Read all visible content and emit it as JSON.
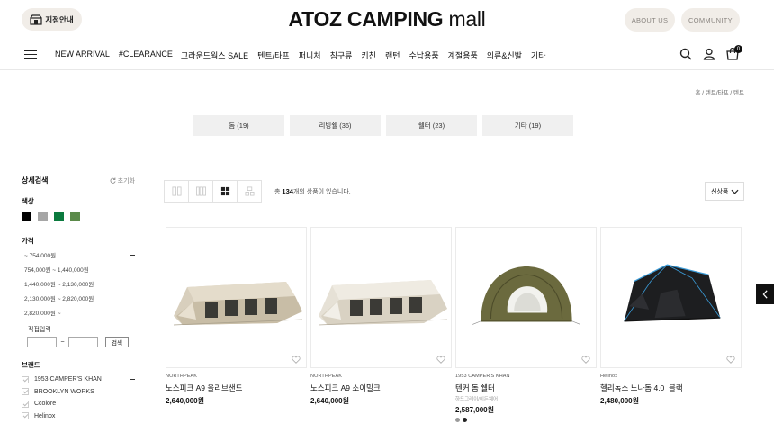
{
  "header": {
    "store_label": "지점안내",
    "logo_bold": "ATOZ CAMPING",
    "logo_light": "mall",
    "about_label": "ABOUT US",
    "community_label": "COMMUNITY"
  },
  "nav": {
    "items": [
      "NEW ARRIVAL",
      "#CLEARANCE",
      "그라운드웍스 SALE",
      "텐트/타프",
      "퍼니처",
      "침구류",
      "키친",
      "랜턴",
      "수납용품",
      "계절용품",
      "의류&신발",
      "기타"
    ],
    "cart_count": "0",
    "icons": [
      "search-icon",
      "user-icon",
      "cart-icon"
    ]
  },
  "breadcrumb": "홈 / 텐트/타프 / 텐트",
  "categories": [
    "돔 (19)",
    "리빙쉘 (36)",
    "쉘터 (23)",
    "기타 (19)"
  ],
  "sidebar": {
    "title": "상세검색",
    "reset": "초기화",
    "color_title": "색상",
    "colors": [
      "#000000",
      "#a6a6a6",
      "#0b7a3e",
      "#5b8a4a"
    ],
    "price_title": "가격",
    "prices": [
      "~ 754,000원",
      "754,000원 ~ 1,440,000원",
      "1,440,000원 ~ 2,130,000원",
      "2,130,000원 ~ 2,820,000원",
      "2,820,000원 ~"
    ],
    "direct_label": "직접입력",
    "search_btn": "검색",
    "brand_title": "브랜드",
    "brands": [
      "1953 CAMPER'S KHAN",
      "BROOKLYN WORKS",
      "Ccolore",
      "Helinox"
    ]
  },
  "toolbar": {
    "count_prefix": "총",
    "count": "134",
    "count_suffix": "개의 상품이 있습니다.",
    "sort_label": "신상품"
  },
  "products": [
    {
      "brand": "NORTHPEAK",
      "name": "노스피크 A9 올리브샌드",
      "sub": "",
      "price": "2,640,000원"
    },
    {
      "brand": "NORTHPEAK",
      "name": "노스피크 A9 소이밀크",
      "sub": "",
      "price": "2,640,000원"
    },
    {
      "brand": "1953 CAMPER'S KHAN",
      "name": "텐커 돔 쉘터",
      "sub": "하드그레이/이든웨어",
      "price": "2,587,000원"
    },
    {
      "brand": "Helinox",
      "name": "헬리녹스 노나돔 4.0_블랙",
      "sub": "",
      "price": "2,480,000원"
    }
  ],
  "product3_colors": [
    "#9a9a9a",
    "#222222"
  ]
}
